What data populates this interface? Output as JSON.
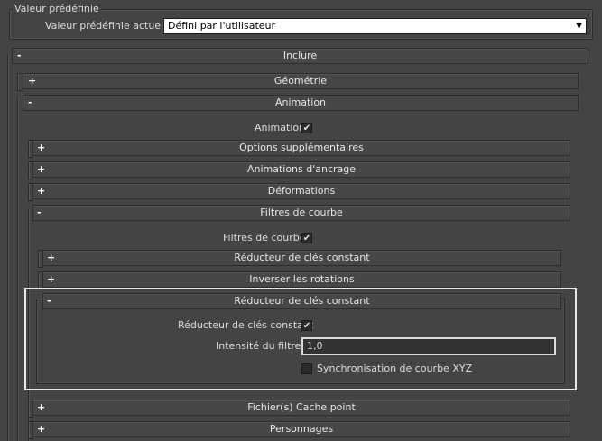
{
  "preset": {
    "group_title": "Valeur prédéfinie",
    "current_label": "Valeur prédéfinie actuelle:",
    "current_value": "Défini par l'utilisateur"
  },
  "sections": {
    "include": "Inclure",
    "geometry": "Géométrie",
    "animation": "Animation",
    "animation_cb_label": "Animation",
    "extra_options": "Options supplémentaires",
    "anchor_animations": "Animations d'ancrage",
    "deformations": "Déformations",
    "curve_filters": "Filtres de courbe",
    "curve_filters_cb_label": "Filtres de courbe",
    "const_key_reducer_1": "Réducteur de clés constant",
    "invert_rotations": "Inverser les rotations",
    "const_key_reducer_2": "Réducteur de clés constant",
    "const_key_reducer_cb_label": "Réducteur de clés constant",
    "filter_intensity_label": "Intensité du filtre:",
    "filter_intensity_value": "1,0",
    "sync_curve_xyz_label": "Synchronisation de courbe XYZ",
    "point_cache": "Fichier(s) Cache point",
    "characters": "Personnages"
  },
  "signs": {
    "plus": "+",
    "minus": "-",
    "check": "✔"
  },
  "checkboxes": {
    "animation": true,
    "curve_filters": true,
    "const_key_reducer": true,
    "sync_curve_xyz": false
  }
}
